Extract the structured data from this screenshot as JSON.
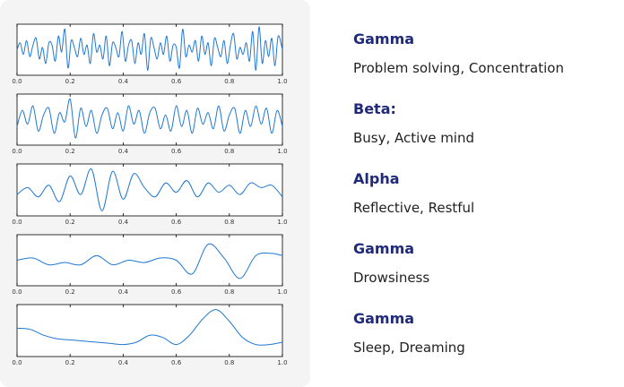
{
  "waves": [
    {
      "title": "Gamma",
      "description": "Problem solving, Concentration"
    },
    {
      "title": "Beta:",
      "description": "Busy, Active mind"
    },
    {
      "title": "Alpha",
      "description": "Reflective, Restful"
    },
    {
      "title": "Gamma",
      "description": "Drowsiness"
    },
    {
      "title": "Gamma",
      "description": "Sleep, Dreaming"
    }
  ],
  "chart_data": [
    {
      "type": "line",
      "xlim": [
        0.0,
        1.0
      ],
      "xticks": [
        "0.0",
        "0.2",
        "0.4",
        "0.6",
        "0.8",
        "1.0"
      ],
      "series": [
        {
          "x": [
            0.0,
            0.012,
            0.024,
            0.036,
            0.048,
            0.06,
            0.072,
            0.084,
            0.096,
            0.108,
            0.12,
            0.132,
            0.144,
            0.156,
            0.168,
            0.18,
            0.192,
            0.204,
            0.216,
            0.228,
            0.24,
            0.252,
            0.264,
            0.276,
            0.288,
            0.3,
            0.312,
            0.324,
            0.336,
            0.348,
            0.36,
            0.372,
            0.384,
            0.396,
            0.408,
            0.42,
            0.432,
            0.444,
            0.456,
            0.468,
            0.48,
            0.492,
            0.504,
            0.516,
            0.528,
            0.54,
            0.552,
            0.564,
            0.576,
            0.588,
            0.6,
            0.612,
            0.624,
            0.636,
            0.648,
            0.66,
            0.672,
            0.684,
            0.696,
            0.708,
            0.72,
            0.732,
            0.744,
            0.756,
            0.768,
            0.78,
            0.792,
            0.804,
            0.816,
            0.828,
            0.84,
            0.852,
            0.864,
            0.876,
            0.888,
            0.9,
            0.912,
            0.924,
            0.936,
            0.948,
            0.96,
            0.972,
            0.984,
            1.0
          ],
          "y": [
            0.0,
            0.3,
            -0.2,
            0.4,
            -0.3,
            0.2,
            0.5,
            -0.4,
            0.1,
            -0.6,
            0.3,
            0.2,
            -0.5,
            0.6,
            -0.1,
            0.9,
            -0.8,
            0.4,
            0.1,
            -0.3,
            0.5,
            -0.2,
            0.2,
            -0.6,
            0.7,
            -0.1,
            0.2,
            -0.4,
            0.6,
            -0.7,
            0.3,
            0.1,
            -0.3,
            0.8,
            -0.5,
            0.2,
            0.4,
            -0.6,
            0.3,
            -0.2,
            0.7,
            -0.9,
            0.5,
            0.1,
            -0.4,
            0.3,
            -0.2,
            0.6,
            -0.5,
            0.2,
            0.1,
            -0.8,
            0.9,
            -0.3,
            0.2,
            -0.1,
            0.4,
            -0.5,
            0.6,
            -0.2,
            0.3,
            -0.7,
            0.5,
            0.1,
            -0.3,
            0.4,
            -0.6,
            0.2,
            0.7,
            -0.4,
            0.1,
            -0.2,
            0.3,
            -0.5,
            0.8,
            -0.9,
            1.0,
            -0.6,
            0.4,
            -0.3,
            0.5,
            -0.7,
            0.6,
            0.0
          ]
        }
      ]
    },
    {
      "type": "line",
      "xlim": [
        0.0,
        1.0
      ],
      "xticks": [
        "0.0",
        "0.2",
        "0.4",
        "0.6",
        "0.8",
        "1.0"
      ],
      "series": [
        {
          "x": [
            0.0,
            0.02,
            0.04,
            0.06,
            0.08,
            0.1,
            0.12,
            0.14,
            0.16,
            0.18,
            0.2,
            0.22,
            0.24,
            0.26,
            0.28,
            0.3,
            0.32,
            0.34,
            0.36,
            0.38,
            0.4,
            0.42,
            0.44,
            0.46,
            0.48,
            0.5,
            0.52,
            0.54,
            0.56,
            0.58,
            0.6,
            0.62,
            0.64,
            0.66,
            0.68,
            0.7,
            0.72,
            0.74,
            0.76,
            0.78,
            0.8,
            0.82,
            0.84,
            0.86,
            0.88,
            0.9,
            0.92,
            0.94,
            0.96,
            0.98,
            1.0
          ],
          "y": [
            -0.3,
            0.4,
            -0.2,
            0.6,
            -0.5,
            0.2,
            0.5,
            -0.6,
            0.3,
            -0.1,
            0.9,
            -0.8,
            0.5,
            -0.3,
            0.4,
            -0.6,
            0.2,
            0.5,
            -0.4,
            0.3,
            -0.5,
            0.6,
            -0.2,
            0.4,
            -0.6,
            0.3,
            0.5,
            -0.4,
            0.2,
            -0.5,
            0.6,
            -0.3,
            0.4,
            -0.6,
            0.5,
            -0.2,
            0.3,
            -0.4,
            0.6,
            -0.5,
            0.2,
            0.5,
            -0.6,
            0.4,
            -0.3,
            0.6,
            -0.2,
            0.5,
            -0.6,
            0.4,
            -0.3
          ]
        }
      ]
    },
    {
      "type": "line",
      "xlim": [
        0.0,
        1.0
      ],
      "xticks": [
        "0.0",
        "0.2",
        "0.4",
        "0.6",
        "0.8",
        "1.0"
      ],
      "series": [
        {
          "x": [
            0.0,
            0.04,
            0.08,
            0.12,
            0.16,
            0.2,
            0.24,
            0.28,
            0.32,
            0.36,
            0.4,
            0.44,
            0.48,
            0.52,
            0.56,
            0.6,
            0.64,
            0.68,
            0.72,
            0.76,
            0.8,
            0.84,
            0.88,
            0.92,
            0.96,
            1.0
          ],
          "y": [
            -0.2,
            0.1,
            -0.3,
            0.2,
            -0.5,
            0.6,
            -0.2,
            0.9,
            -0.9,
            0.8,
            -0.4,
            0.7,
            0.1,
            -0.3,
            0.3,
            -0.1,
            0.4,
            -0.3,
            0.3,
            -0.1,
            0.2,
            -0.2,
            0.3,
            0.1,
            0.2,
            -0.3
          ]
        }
      ]
    },
    {
      "type": "line",
      "xlim": [
        0.0,
        1.0
      ],
      "xticks": [
        "0.0",
        "0.2",
        "0.4",
        "0.6",
        "0.8",
        "1.0"
      ],
      "series": [
        {
          "x": [
            0.0,
            0.06,
            0.12,
            0.18,
            0.24,
            0.3,
            0.36,
            0.42,
            0.48,
            0.54,
            0.6,
            0.66,
            0.72,
            0.78,
            0.84,
            0.9,
            0.96,
            1.0
          ],
          "y": [
            0.0,
            0.1,
            -0.2,
            -0.1,
            -0.2,
            0.2,
            -0.2,
            0.0,
            -0.1,
            0.1,
            0.0,
            -0.6,
            0.7,
            0.1,
            -0.8,
            0.2,
            0.3,
            0.2
          ]
        }
      ]
    },
    {
      "type": "line",
      "xlim": [
        0.0,
        1.0
      ],
      "xticks": [
        "0.0",
        "0.2",
        "0.4",
        "0.6",
        "0.8",
        "1.0"
      ],
      "series": [
        {
          "x": [
            0.0,
            0.05,
            0.1,
            0.15,
            0.2,
            0.25,
            0.3,
            0.35,
            0.4,
            0.45,
            0.5,
            0.55,
            0.6,
            0.65,
            0.7,
            0.75,
            0.8,
            0.85,
            0.9,
            0.95,
            1.0
          ],
          "y": [
            0.1,
            0.05,
            -0.2,
            -0.35,
            -0.4,
            -0.45,
            -0.5,
            -0.55,
            -0.6,
            -0.5,
            -0.2,
            -0.3,
            -0.6,
            -0.2,
            0.5,
            0.9,
            0.4,
            -0.3,
            -0.6,
            -0.6,
            -0.5
          ]
        }
      ]
    }
  ]
}
